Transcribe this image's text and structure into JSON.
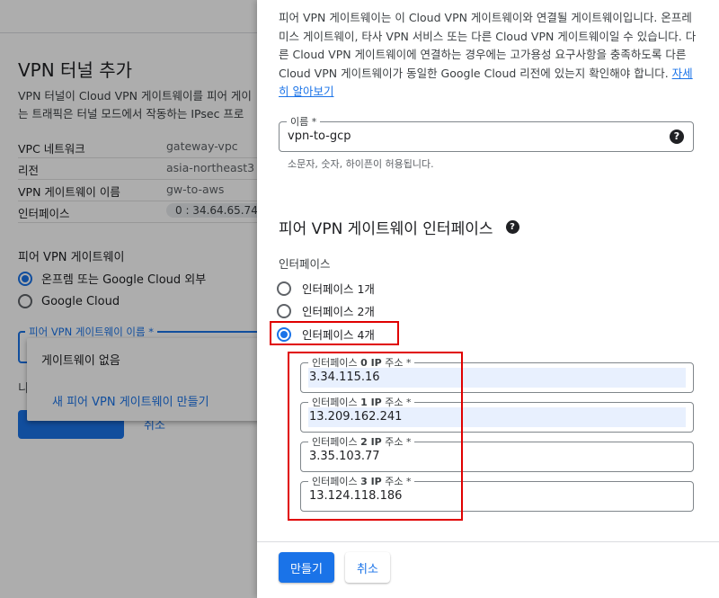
{
  "background": {
    "title": "VPN 터널 추가",
    "desc_lines": [
      "VPN 터널이 Cloud VPN 게이트웨이를 피어 게이",
      "는 트래픽은 터널 모드에서 작동하는 IPsec 프로"
    ],
    "summary": [
      {
        "key": "VPC 네트워크",
        "value": "gateway-vpc"
      },
      {
        "key": "리전",
        "value": "asia-northeast3"
      },
      {
        "key": "VPN 게이트웨이 이름",
        "value": "gw-to-aws"
      },
      {
        "key": "인터페이스",
        "value": "0 : 34.64.65.74"
      }
    ],
    "peer_section_label": "피어 VPN 게이트웨이",
    "peer_options": [
      "온프렘 또는 Google Cloud 외부",
      "Google Cloud"
    ],
    "peer_select_label": "피어 VPN 게이트웨이 이름 *",
    "truncated_text": "니",
    "cancel_partial": "취소",
    "dropdown": {
      "items": [
        "게이트웨이 없음",
        "새 피어 VPN 게이트웨이 만들기"
      ]
    }
  },
  "panel": {
    "intro": "피어 VPN 게이트웨이는 이 Cloud VPN 게이트웨이와 연결될 게이트웨이입니다. 온프레미스 게이트웨이, 타사 VPN 서비스 또는 다른 Cloud VPN 게이트웨이일 수 있습니다. 다른 Cloud VPN 게이트웨이에 연결하는 경우에는 고가용성 요구사항을 충족하도록 다른 Cloud VPN 게이트웨이가 동일한 Google Cloud 리전에 있는지 확인해야 합니다.",
    "learn_more": "자세히 알아보기",
    "name_field": {
      "label": "이름 *",
      "value": "vpn-to-gcp",
      "hint": "소문자, 숫자, 하이픈이 허용됩니다."
    },
    "section_title": "피어 VPN 게이트웨이 인터페이스",
    "interfaces_label": "인터페이스",
    "interface_options": [
      "인터페이스 1개",
      "인터페이스 2개",
      "인터페이스 4개"
    ],
    "selected_option_index": 2,
    "ip_fields": [
      {
        "label_prefix": "인터페이스 ",
        "label_bold": "0 IP",
        "label_suffix": " 주소 *",
        "value": "3.34.115.16"
      },
      {
        "label_prefix": "인터페이스 ",
        "label_bold": "1 IP",
        "label_suffix": " 주소 *",
        "value": "13.209.162.241"
      },
      {
        "label_prefix": "인터페이스 ",
        "label_bold": "2 IP",
        "label_suffix": " 주소 *",
        "value": "3.35.103.77"
      },
      {
        "label_prefix": "인터페이스 ",
        "label_bold": "3 IP",
        "label_suffix": " 주소 *",
        "value": "13.124.118.186"
      }
    ],
    "create_button": "만들기",
    "cancel_button": "취소"
  },
  "colors": {
    "accent": "#1a73e8",
    "highlight": "#e00000",
    "autofill": "#e8f0fe"
  }
}
